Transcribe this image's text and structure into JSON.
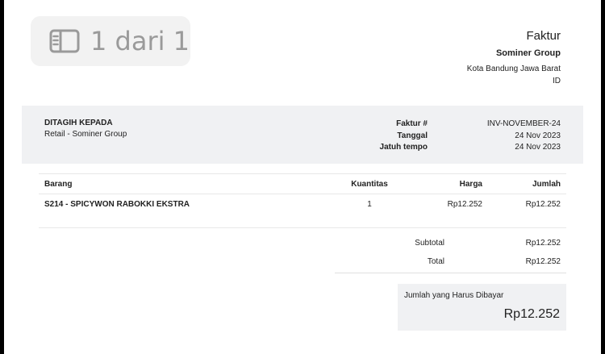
{
  "viewer": {
    "page_indicator": "1 dari 1",
    "icon": "sidebar-icon"
  },
  "company": {
    "doc_title": "Faktur",
    "name": "Sominer Group",
    "city": "Kota Bandung Jawa Barat",
    "country": "ID"
  },
  "bill_to": {
    "label": "DITAGIH KEPADA",
    "value": "Retail - Sominer Group"
  },
  "meta": {
    "invoice_label": "Faktur #",
    "invoice_value": "INV-NOVEMBER-24",
    "date_label": "Tanggal",
    "date_value": "24 Nov 2023",
    "due_label": "Jatuh tempo",
    "due_value": "24 Nov 2023"
  },
  "table": {
    "headers": {
      "item": "Barang",
      "qty": "Kuantitas",
      "price": "Harga",
      "total": "Jumlah"
    },
    "rows": [
      {
        "item": "S214 - SPICYWON RABOKKI EKSTRA",
        "qty": "1",
        "price": "Rp12.252",
        "total": "Rp12.252"
      }
    ]
  },
  "totals": {
    "subtotal_label": "Subtotal",
    "subtotal_value": "Rp12.252",
    "total_label": "Total",
    "total_value": "Rp12.252"
  },
  "amount_due": {
    "label": "Jumlah yang Harus Dibayar",
    "value": "Rp12.252"
  }
}
